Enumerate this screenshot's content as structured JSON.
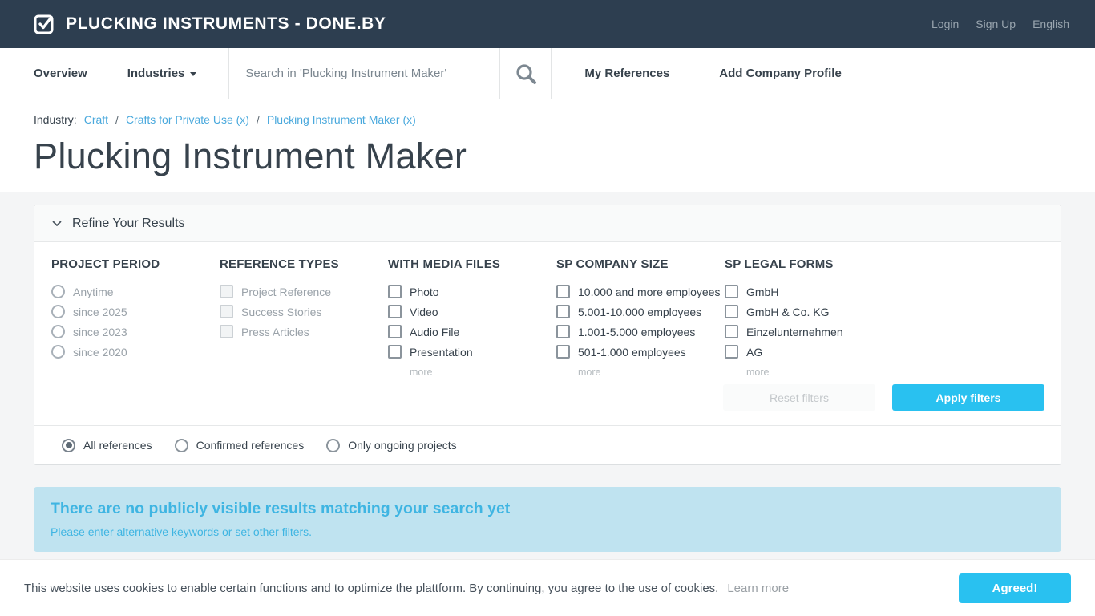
{
  "header": {
    "logo_text": "PLUCKING INSTRUMENTS - DONE.BY",
    "links": [
      {
        "label": "Login"
      },
      {
        "label": "Sign Up"
      },
      {
        "label": "English"
      }
    ]
  },
  "nav": {
    "overview": "Overview",
    "industries": "Industries",
    "search_placeholder": "Search in 'Plucking Instrument Maker'",
    "search_value": "",
    "my_references": "My References",
    "add_company_profile": "Add Company Profile"
  },
  "breadcrumb": {
    "prefix": "Industry:",
    "separator": "/",
    "items": [
      {
        "label": "Craft"
      },
      {
        "label": "Crafts for Private Use (x)"
      },
      {
        "label": "Plucking Instrument Maker (x)"
      }
    ]
  },
  "page_title": "Plucking Instrument Maker",
  "refine": {
    "title": "Refine Your Results",
    "more_label": "more",
    "reset_button": "Reset filters",
    "apply_button": "Apply filters",
    "columns": [
      {
        "heading": "PROJECT PERIOD",
        "control": "radio",
        "state": "disabled",
        "options": [
          "Anytime",
          "since 2025",
          "since 2023",
          "since 2020"
        ]
      },
      {
        "heading": "REFERENCE TYPES",
        "control": "checkbox",
        "state": "disabled",
        "options": [
          "Project Reference",
          "Success Stories",
          "Press Articles"
        ]
      },
      {
        "heading": "WITH MEDIA FILES",
        "control": "checkbox",
        "state": "enabled",
        "options": [
          "Photo",
          "Video",
          "Audio File",
          "Presentation"
        ],
        "has_more": true
      },
      {
        "heading": "SP COMPANY SIZE",
        "control": "checkbox",
        "state": "enabled",
        "options": [
          "10.000 and more employees",
          "5.001-10.000 employees",
          "1.001-5.000 employees",
          "501-1.000 employees"
        ],
        "has_more": true
      },
      {
        "heading": "SP LEGAL FORMS",
        "control": "checkbox",
        "state": "enabled",
        "options": [
          "GmbH",
          "GmbH & Co. KG",
          "Einzelunternehmen",
          "AG"
        ],
        "has_more": true
      }
    ]
  },
  "reference_scope": {
    "options": [
      {
        "label": "All references",
        "selected": true
      },
      {
        "label": "Confirmed references",
        "selected": false
      },
      {
        "label": "Only ongoing projects",
        "selected": false
      }
    ]
  },
  "empty_state": {
    "title": "There are no publicly visible results matching your search yet",
    "subtitle": "Please enter alternative keywords or set other filters."
  },
  "cookie_bar": {
    "message": "This website uses cookies to enable certain functions and to optimize the plattform. By continuing, you agree to the use of cookies.",
    "learn_more": "Learn more",
    "agree_button": "Agreed!"
  },
  "colors": {
    "header_bg": "#2d3e50",
    "accent_cyan": "#29c1f0",
    "breadcrumb_link": "#4aa9dd",
    "info_box_bg": "#bfe3f0",
    "info_box_text": "#3fb5e2"
  }
}
